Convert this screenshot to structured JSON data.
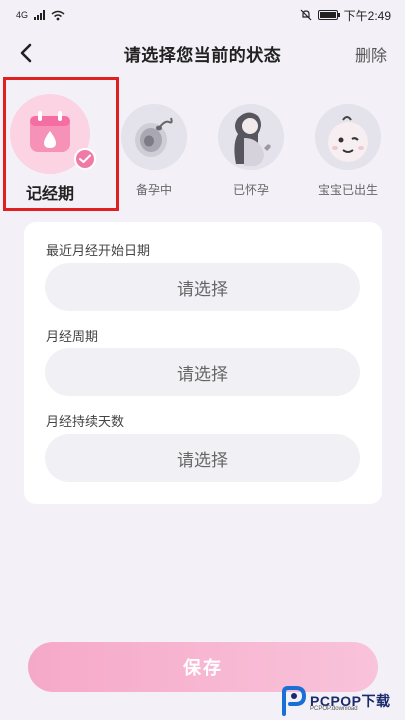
{
  "status_bar": {
    "network": "4G",
    "time": "下午2:49"
  },
  "nav": {
    "title": "请选择您当前的状态",
    "delete_label": "删除"
  },
  "status_options": [
    {
      "label": "记经期",
      "icon": "calendar-drop-icon",
      "selected": true
    },
    {
      "label": "备孕中",
      "icon": "sperm-egg-icon",
      "selected": false
    },
    {
      "label": "已怀孕",
      "icon": "pregnant-woman-icon",
      "selected": false
    },
    {
      "label": "宝宝已出生",
      "icon": "baby-face-icon",
      "selected": false
    }
  ],
  "form": {
    "fields": [
      {
        "label": "最近月经开始日期",
        "placeholder": "请选择"
      },
      {
        "label": "月经周期",
        "placeholder": "请选择"
      },
      {
        "label": "月经持续天数",
        "placeholder": "请选择"
      }
    ]
  },
  "save_label": "保存",
  "watermark": {
    "brand": "PCPOP下载",
    "sub": "PCPOP.download"
  },
  "colors": {
    "accent_pink": "#f07aa6",
    "save_gradient_start": "#f5a9c8",
    "save_gradient_end": "#f9c3da",
    "highlight_frame": "#e02020",
    "background": "#f3f1f7"
  }
}
